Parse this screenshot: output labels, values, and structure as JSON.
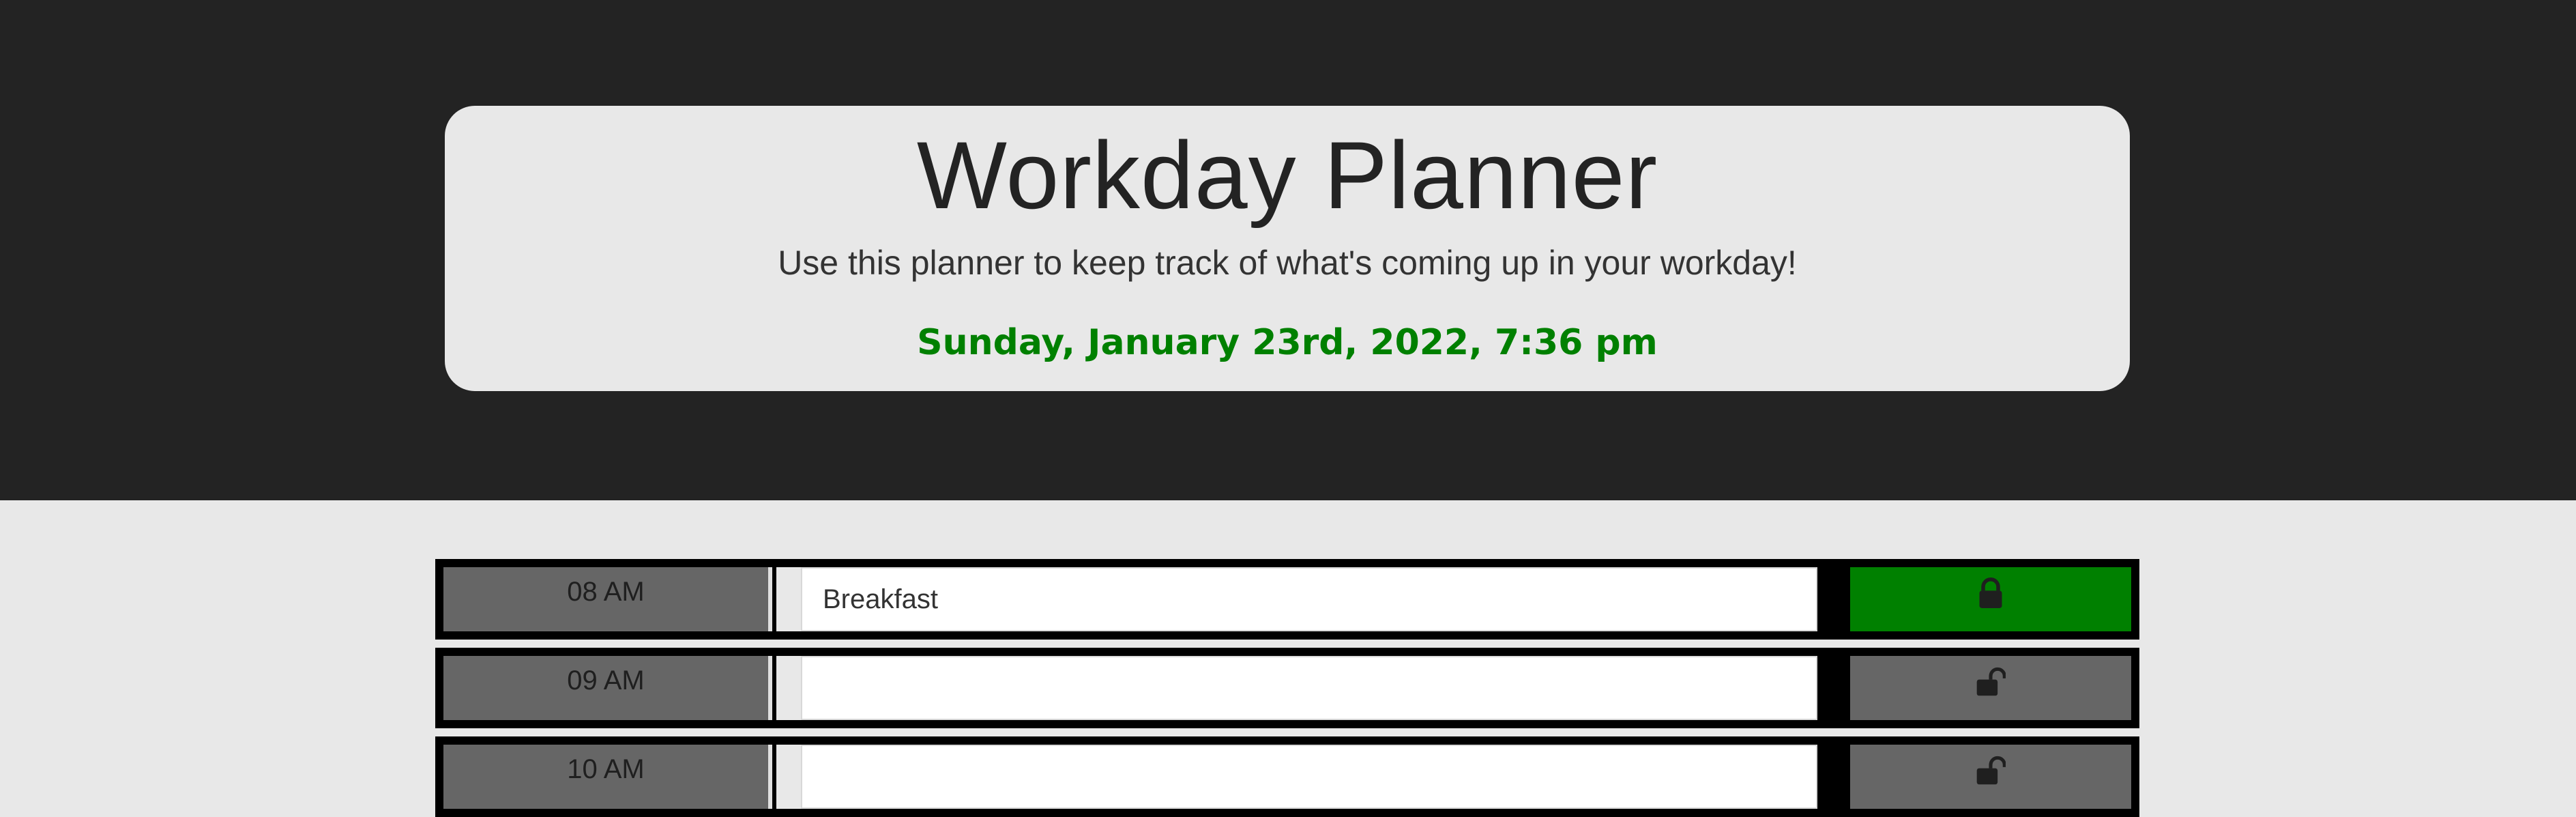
{
  "header": {
    "title": "Workday Planner",
    "lead": "Use this planner to keep track of what's coming up in your workday!",
    "current_date": "Sunday, January 23rd, 2022, 7:36 pm"
  },
  "colors": {
    "date_text": "#008000",
    "saved_button": "#008000",
    "unsaved_button": "#666666"
  },
  "time_blocks": [
    {
      "hour": "08 AM",
      "task": "Breakfast",
      "placeholder": "",
      "lock_icon": "lock-icon"
    },
    {
      "hour": "09 AM",
      "task": "",
      "placeholder": "",
      "lock_icon": "unlock-icon"
    },
    {
      "hour": "10 AM",
      "task": "",
      "placeholder": "",
      "lock_icon": "unlock-icon"
    }
  ]
}
